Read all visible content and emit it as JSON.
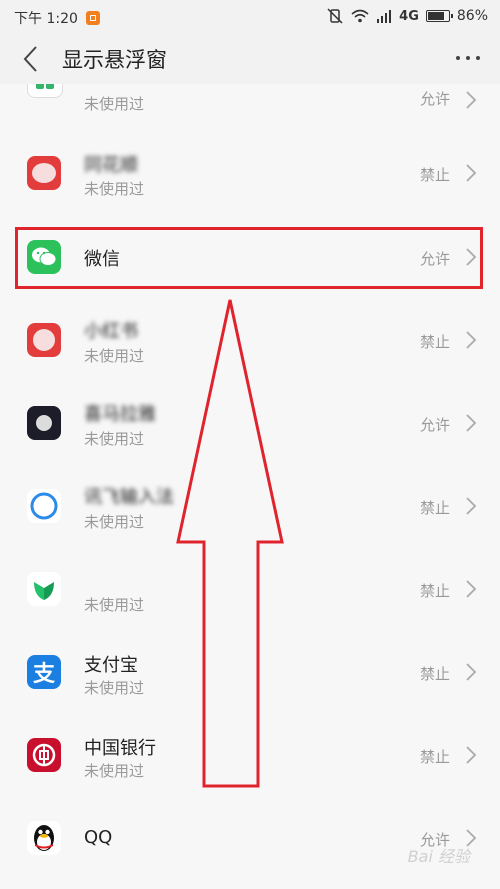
{
  "status_bar": {
    "time": "下午 1:20",
    "network": "4G",
    "battery": "86%"
  },
  "header": {
    "title": "显示悬浮窗"
  },
  "apps": [
    {
      "name": "",
      "sub": "未使用过",
      "status": "允许",
      "icon": "green-blue-app-icon"
    },
    {
      "name": "同花顺",
      "sub": "未使用过",
      "status": "禁止",
      "icon": "red-app-icon"
    },
    {
      "name": "微信",
      "sub": "",
      "status": "允许",
      "icon": "wechat-icon"
    },
    {
      "name": "小红书",
      "sub": "未使用过",
      "status": "禁止",
      "icon": "red-app-icon"
    },
    {
      "name": "喜马拉雅",
      "sub": "未使用过",
      "status": "允许",
      "icon": "dark-app-icon"
    },
    {
      "name": "讯飞输入法",
      "sub": "未使用过",
      "status": "禁止",
      "icon": "iflytek-icon"
    },
    {
      "name": "",
      "sub": "未使用过",
      "status": "禁止",
      "icon": "green-leaf-icon"
    },
    {
      "name": "支付宝",
      "sub": "未使用过",
      "status": "禁止",
      "icon": "alipay-icon"
    },
    {
      "name": "中国银行",
      "sub": "未使用过",
      "status": "禁止",
      "icon": "bank-of-china-icon"
    },
    {
      "name": "QQ",
      "sub": "",
      "status": "允许",
      "icon": "qq-penguin-icon"
    }
  ],
  "colors": {
    "annotation_red": "#e0242d",
    "wechat_green": "#2dc15c",
    "alipay_blue": "#1a7fe0",
    "boc_red": "#c8102e"
  },
  "watermark": "Bai 经验"
}
